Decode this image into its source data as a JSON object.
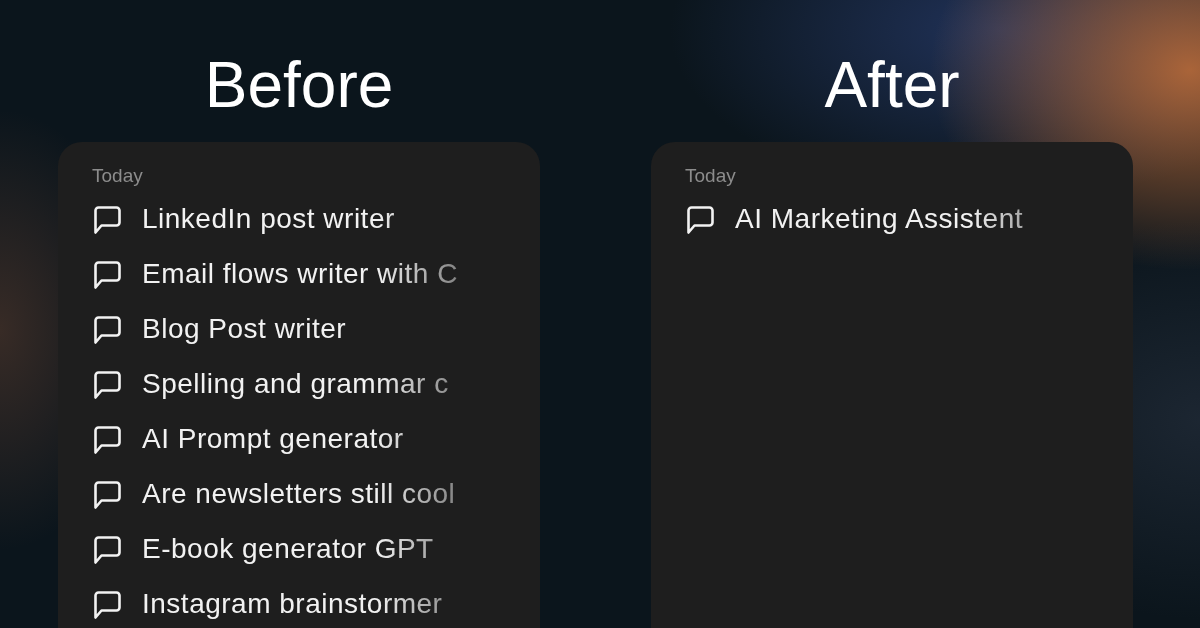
{
  "panels": [
    {
      "title": "Before",
      "section": "Today",
      "items": [
        {
          "label": "LinkedIn post writer"
        },
        {
          "label": "Email flows writer with C"
        },
        {
          "label": "Blog Post writer"
        },
        {
          "label": "Spelling and grammar c"
        },
        {
          "label": "AI Prompt generator"
        },
        {
          "label": "Are newsletters still cool"
        },
        {
          "label": "E-book generator GPT"
        },
        {
          "label": "Instagram brainstormer"
        }
      ]
    },
    {
      "title": "After",
      "section": "Today",
      "items": [
        {
          "label": "AI Marketing Assistent"
        }
      ]
    }
  ]
}
